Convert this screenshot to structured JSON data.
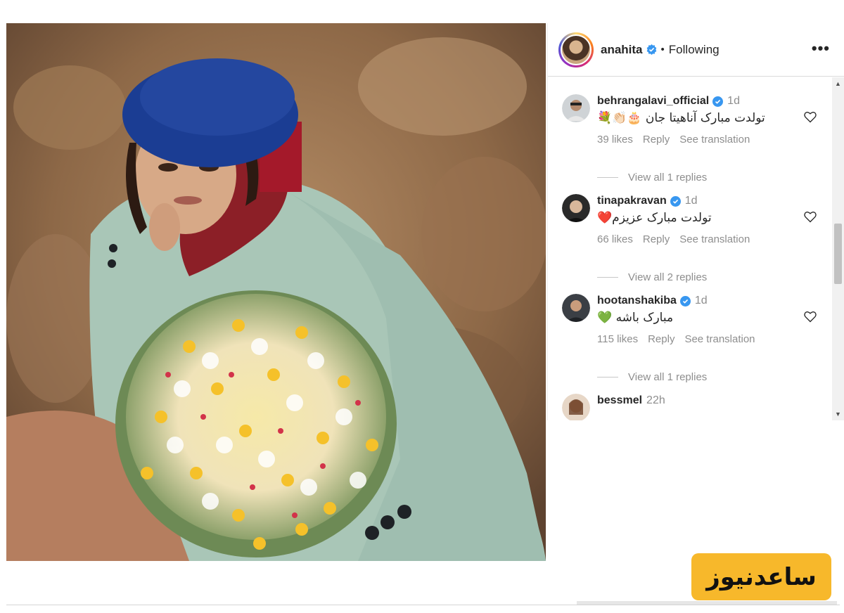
{
  "post": {
    "author": "anahita",
    "separator": "•",
    "follow_status": "Following",
    "more_label": "•••"
  },
  "comments": [
    {
      "username": "behrangalavi_official",
      "verified": true,
      "time": "1d",
      "text": "تولدت مبارک آناهیتا جان 🎂👏🏻💐",
      "likes": "39 likes",
      "reply": "Reply",
      "translate": "See translation",
      "view_replies": "View all 1 replies"
    },
    {
      "username": "tinapakravan",
      "verified": true,
      "time": "1d",
      "text": "تولدت مبارک عزیزم❤️",
      "likes": "66 likes",
      "reply": "Reply",
      "translate": "See translation",
      "view_replies": "View all 2 replies"
    },
    {
      "username": "hootanshakiba",
      "verified": true,
      "time": "1d",
      "text": "مبارک باشه 💚",
      "likes": "115 likes",
      "reply": "Reply",
      "translate": "See translation",
      "view_replies": "View all 1 replies"
    },
    {
      "username": "bessmel",
      "verified": false,
      "time": "22h"
    }
  ],
  "watermark": {
    "text": "ساعدنیوز"
  },
  "colors": {
    "verified_blue": "#3897f0",
    "secondary_text": "#8e8e8e",
    "watermark_bg": "#f7b82b"
  },
  "icons": {
    "verified": "verified-badge-icon",
    "heart": "heart-outline-icon",
    "more": "more-options-icon"
  }
}
